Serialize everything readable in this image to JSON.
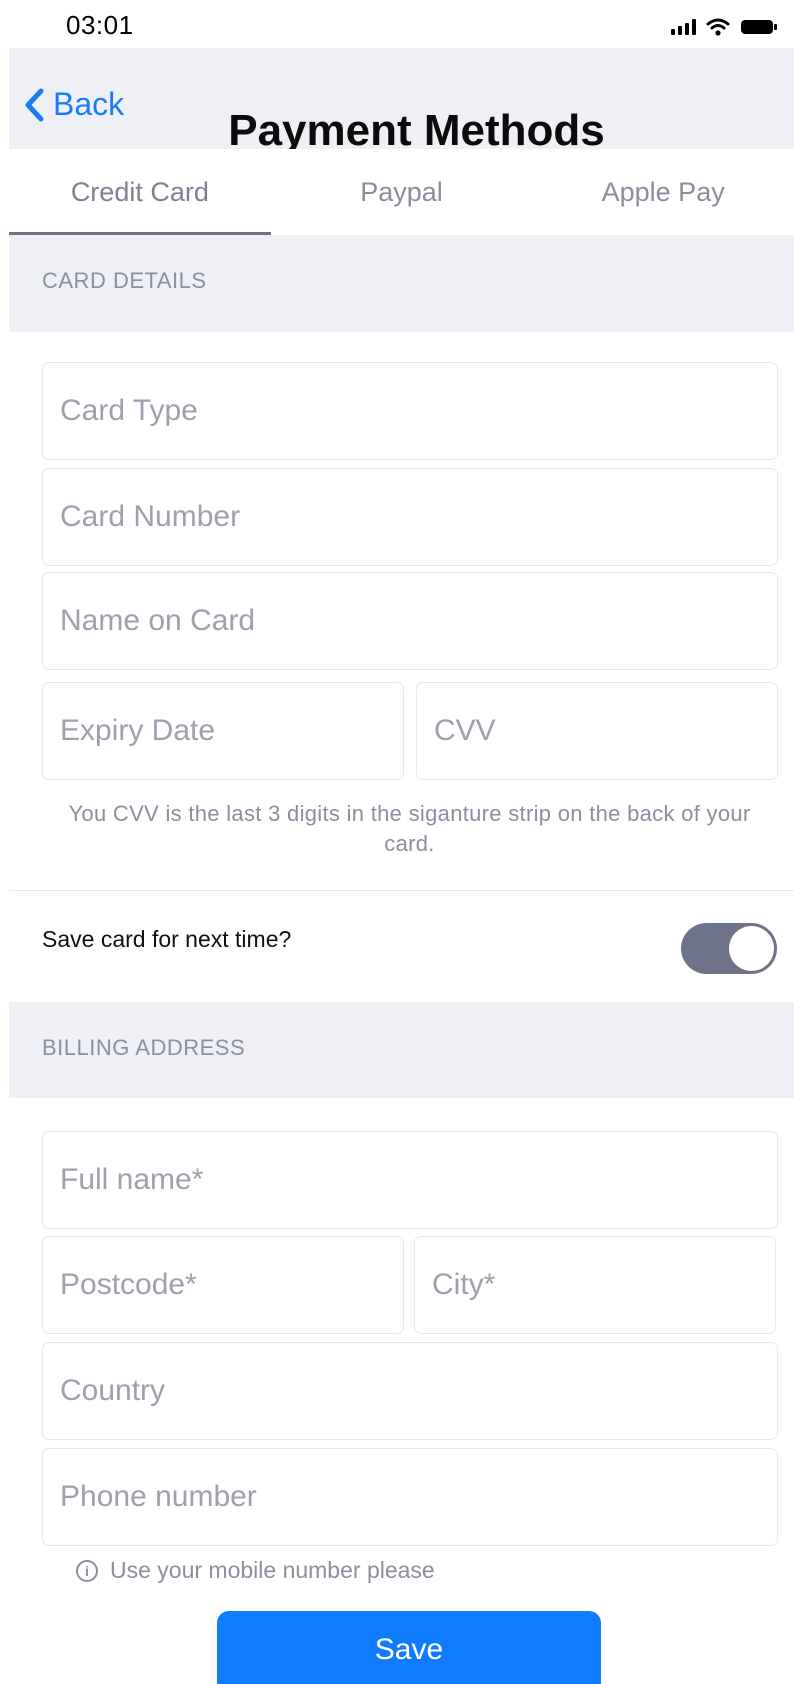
{
  "status_bar": {
    "time": "03:01"
  },
  "nav": {
    "back_label": "Back",
    "title": "Payment Methods"
  },
  "tabs": [
    {
      "label": "Credit Card",
      "active": true
    },
    {
      "label": "Paypal",
      "active": false
    },
    {
      "label": "Apple Pay",
      "active": false
    }
  ],
  "card_section": {
    "header": "CARD DETAILS",
    "fields": {
      "card_type": "Card Type",
      "card_number": "Card Number",
      "name_on_card": "Name on Card",
      "expiry_date": "Expiry Date",
      "cvv": "CVV"
    },
    "cvv_hint": "You CVV is the last 3 digits in the siganture strip on the back of your card.",
    "save_card_label": "Save card for next time?",
    "save_card_enabled": true
  },
  "billing_section": {
    "header": "BILLING ADDRESS",
    "fields": {
      "full_name": "Full name*",
      "postcode": "Postcode*",
      "city": "City*",
      "country": "Country",
      "phone": "Phone number"
    },
    "phone_hint": "Use your mobile number please"
  },
  "save_button": "Save",
  "colors": {
    "accent": "#0f7bff",
    "back_link": "#1a7cf5",
    "header_bg": "#eef0f5",
    "toggle_on": "#6e738a"
  }
}
